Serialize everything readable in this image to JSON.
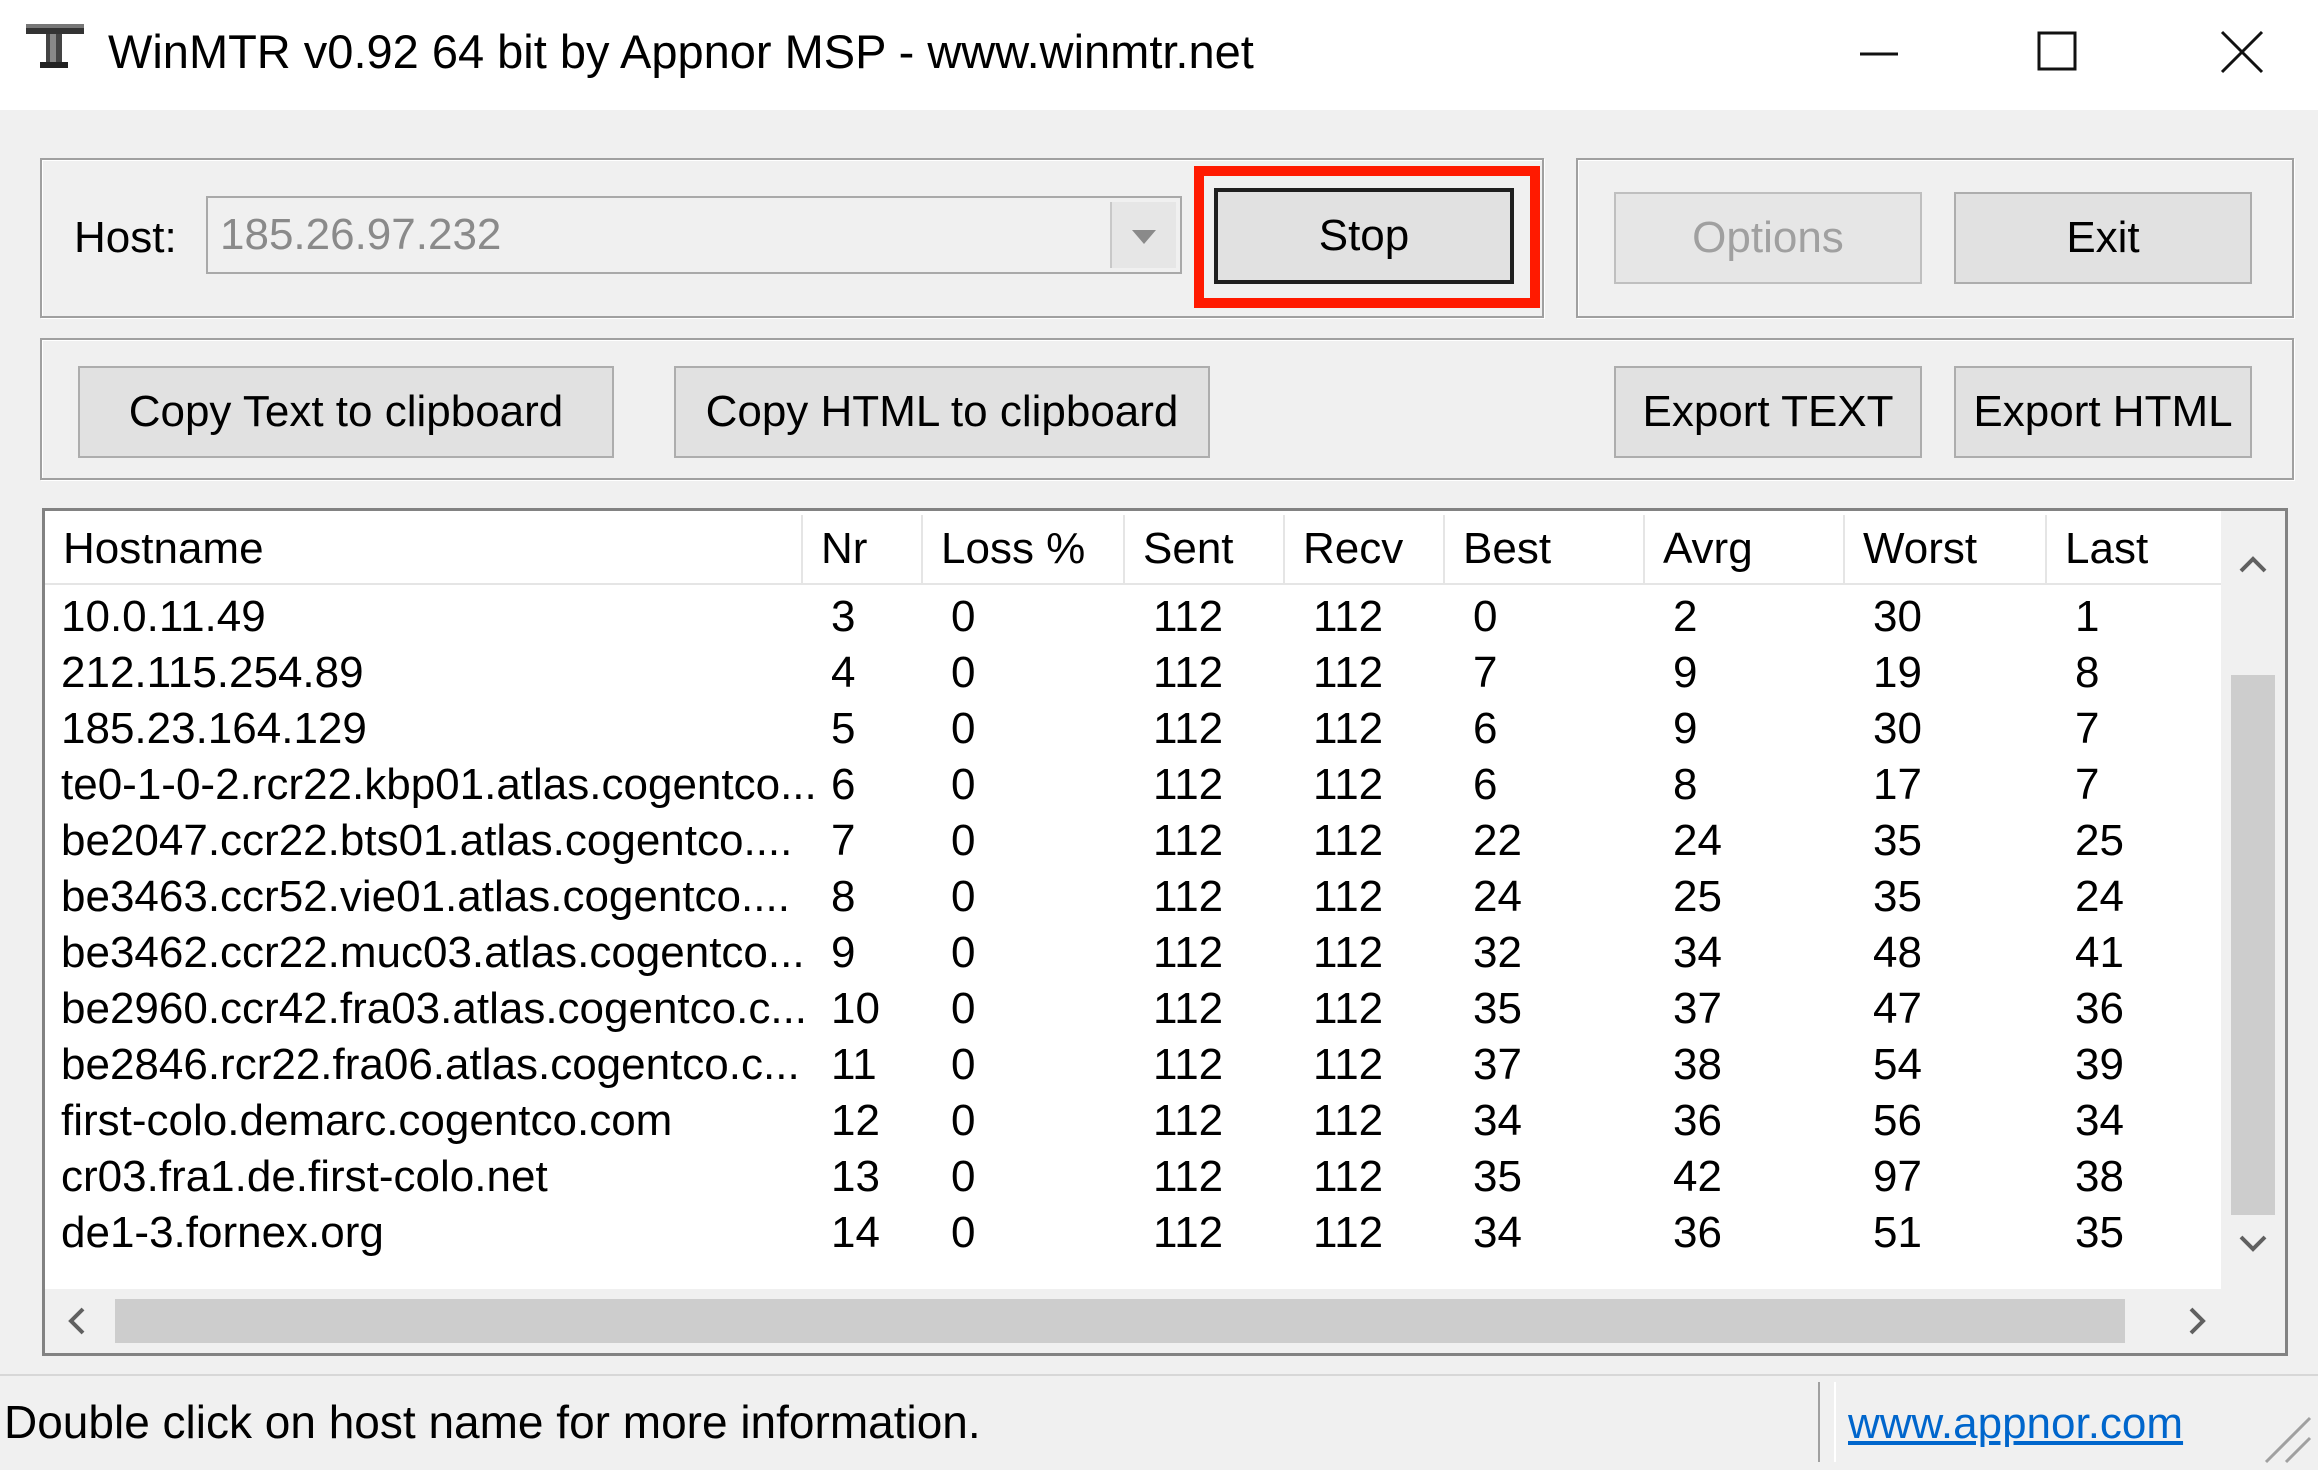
{
  "window": {
    "title": "WinMTR v0.92 64 bit by Appnor MSP - www.winmtr.net"
  },
  "toolbar": {
    "host_label": "Host:",
    "host_value": "185.26.97.232",
    "stop_label": "Stop",
    "options_label": "Options",
    "exit_label": "Exit",
    "copy_text_label": "Copy Text to clipboard",
    "copy_html_label": "Copy HTML to clipboard",
    "export_text_label": "Export TEXT",
    "export_html_label": "Export HTML"
  },
  "table": {
    "columns": [
      "Hostname",
      "Nr",
      "Loss %",
      "Sent",
      "Recv",
      "Best",
      "Avrg",
      "Worst",
      "Last"
    ],
    "rows": [
      [
        "10.0.11.49",
        "3",
        "0",
        "112",
        "112",
        "0",
        "2",
        "30",
        "1"
      ],
      [
        "212.115.254.89",
        "4",
        "0",
        "112",
        "112",
        "7",
        "9",
        "19",
        "8"
      ],
      [
        "185.23.164.129",
        "5",
        "0",
        "112",
        "112",
        "6",
        "9",
        "30",
        "7"
      ],
      [
        "te0-1-0-2.rcr22.kbp01.atlas.cogentco...",
        "6",
        "0",
        "112",
        "112",
        "6",
        "8",
        "17",
        "7"
      ],
      [
        "be2047.ccr22.bts01.atlas.cogentco....",
        "7",
        "0",
        "112",
        "112",
        "22",
        "24",
        "35",
        "25"
      ],
      [
        "be3463.ccr52.vie01.atlas.cogentco....",
        "8",
        "0",
        "112",
        "112",
        "24",
        "25",
        "35",
        "24"
      ],
      [
        "be3462.ccr22.muc03.atlas.cogentco...",
        "9",
        "0",
        "112",
        "112",
        "32",
        "34",
        "48",
        "41"
      ],
      [
        "be2960.ccr42.fra03.atlas.cogentco.c...",
        "10",
        "0",
        "112",
        "112",
        "35",
        "37",
        "47",
        "36"
      ],
      [
        "be2846.rcr22.fra06.atlas.cogentco.c...",
        "11",
        "0",
        "112",
        "112",
        "37",
        "38",
        "54",
        "39"
      ],
      [
        "first-colo.demarc.cogentco.com",
        "12",
        "0",
        "112",
        "112",
        "34",
        "36",
        "56",
        "34"
      ],
      [
        "cr03.fra1.de.first-colo.net",
        "13",
        "0",
        "112",
        "112",
        "35",
        "42",
        "97",
        "38"
      ],
      [
        "de1-3.fornex.org",
        "14",
        "0",
        "112",
        "112",
        "34",
        "36",
        "51",
        "35"
      ]
    ]
  },
  "status": {
    "text": "Double click on host name for more information.",
    "link": "www.appnor.com"
  },
  "icons": {
    "app": "winmtr-app-icon",
    "minimize": "minimize-icon",
    "maximize": "maximize-icon",
    "close": "close-icon",
    "dropdown": "chevron-down-icon"
  },
  "colors": {
    "highlight": "#ff1a00",
    "link": "#0066cc"
  }
}
